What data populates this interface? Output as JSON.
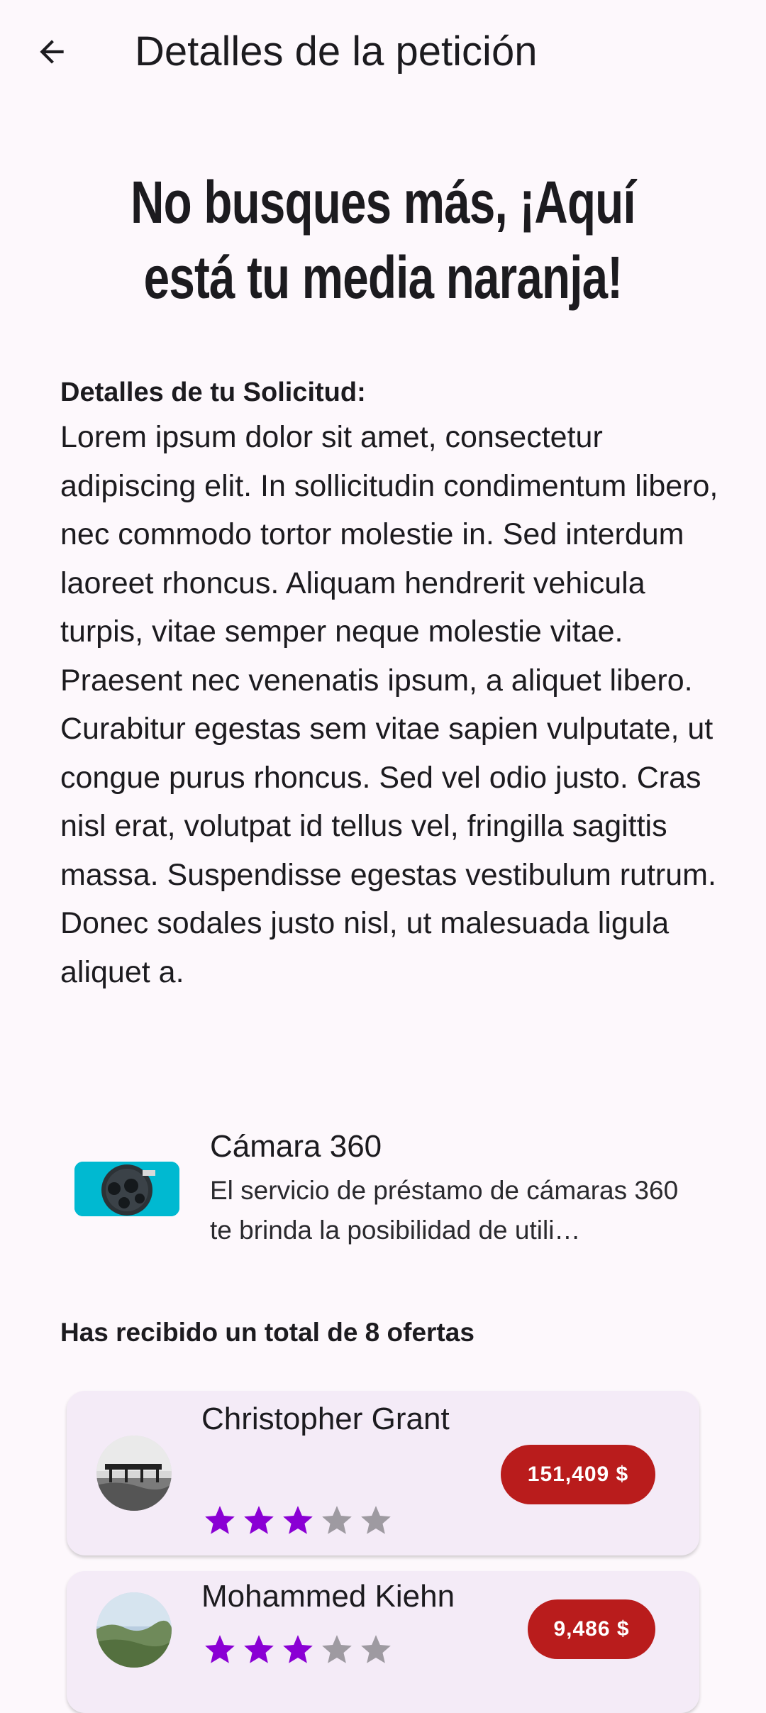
{
  "appbar": {
    "title": "Detalles de la petición",
    "back_icon": "arrow-left-icon"
  },
  "headline": "No busques más, ¡Aquí está tu media naranja!",
  "request": {
    "label": "Detalles de tu Solicitud:",
    "description": "Lorem ipsum dolor sit amet, consectetur adipiscing elit. In sollicitudin condimentum libero, nec commodo tortor molestie in. Sed interdum laoreet rhoncus. Aliquam hendrerit vehicula turpis, vitae semper neque molestie vitae. Praesent nec venenatis ipsum, a aliquet libero. Curabitur egestas sem vitae sapien vulputate, ut congue purus rhoncus. Sed vel odio justo. Cras nisl erat, volutpat id tellus vel, fringilla sagittis massa. Suspendisse egestas vestibulum rutrum. Donec sodales justo nisl, ut malesuada ligula aliquet a."
  },
  "product": {
    "title": "Cámara 360",
    "description": "El servicio de préstamo de cámaras 360 te brinda la posibilidad de utili…"
  },
  "offers": {
    "summary": "Has recibido un total de 8 ofertas",
    "items": [
      {
        "name": "Christopher Grant",
        "rating": 3,
        "max_rating": 5,
        "price": "151,409 $"
      },
      {
        "name": "Mohammed Kiehn",
        "rating": 3,
        "max_rating": 5,
        "price": "9,486 $"
      }
    ]
  },
  "colors": {
    "background": "#fdf8fc",
    "card": "#f4ebf7",
    "star_filled": "#8a00d4",
    "star_empty": "#9e9aa1",
    "price_badge": "#b91c1c",
    "product_thumb": "#00b9d1"
  }
}
